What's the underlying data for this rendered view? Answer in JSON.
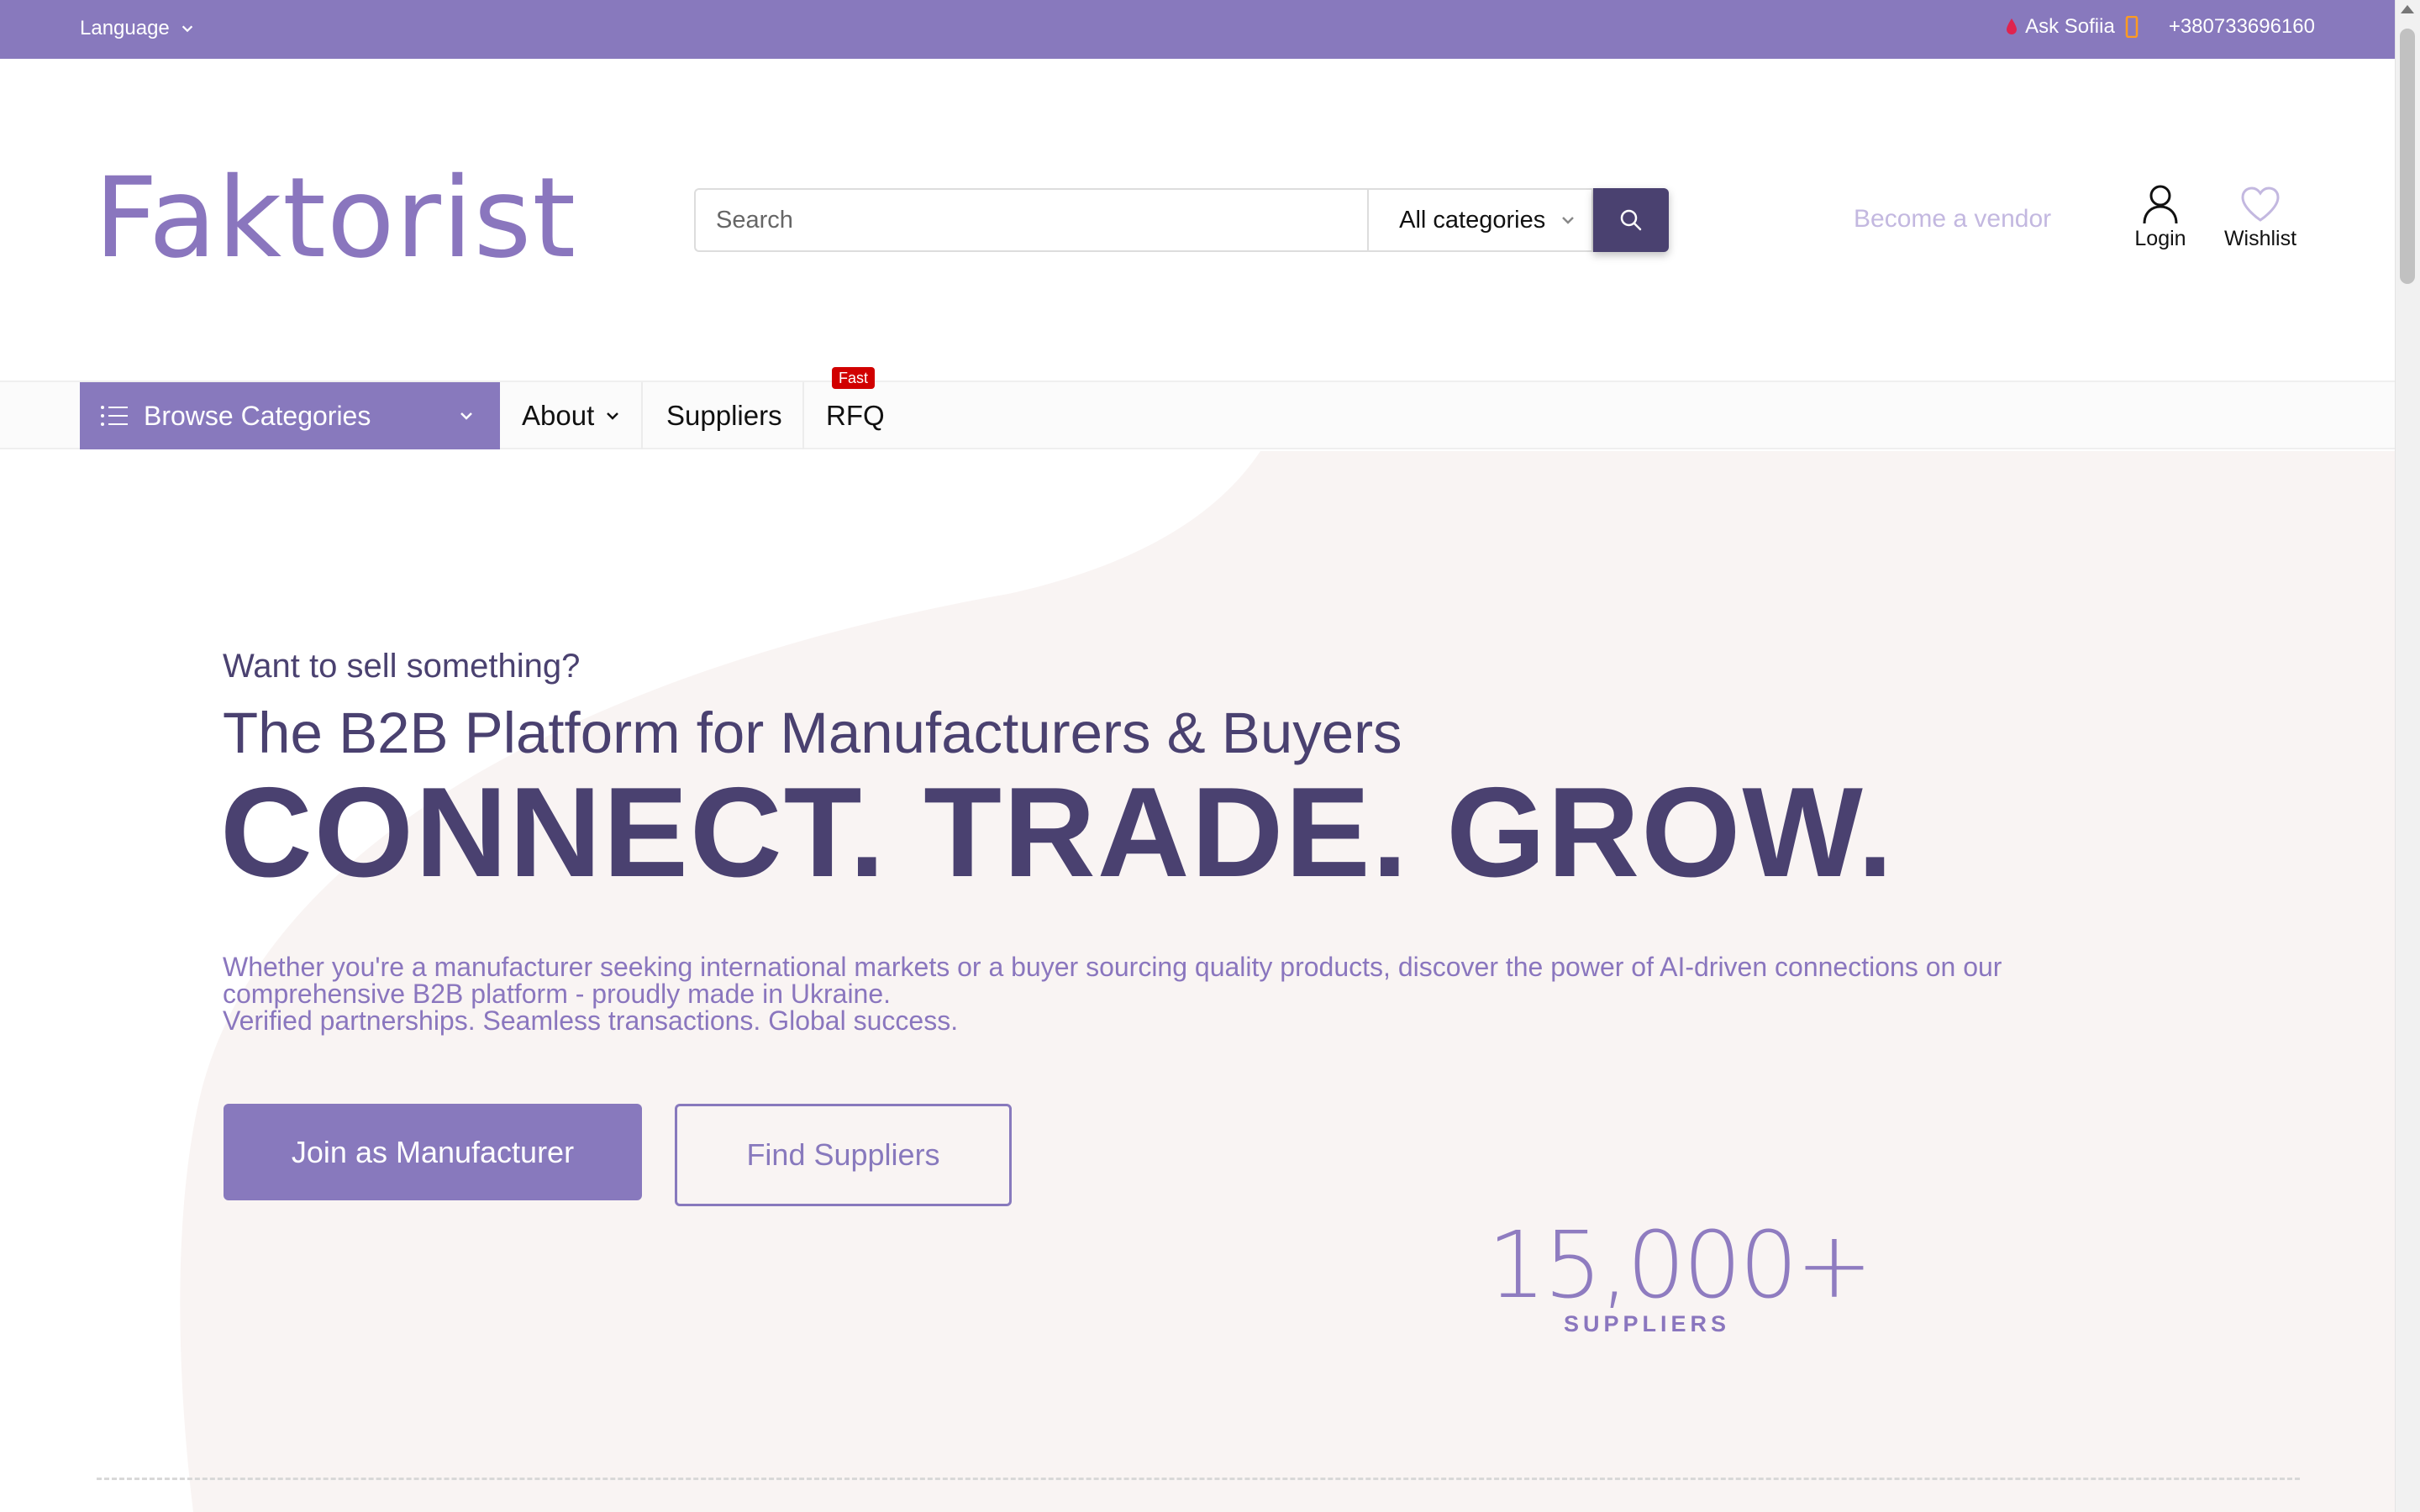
{
  "topbar": {
    "language_label": "Language",
    "ask_label": "Ask Sofiia",
    "phone": "+380733696160"
  },
  "header": {
    "logo_text": "Faktorist",
    "search": {
      "placeholder": "Search",
      "value": ""
    },
    "category_select": "All categories",
    "become_vendor": "Become a vendor",
    "login_label": "Login",
    "wishlist_label": "Wishlist"
  },
  "nav": {
    "browse_label": "Browse Categories",
    "items": [
      {
        "label": "About"
      },
      {
        "label": "Suppliers"
      },
      {
        "label": "RFQ",
        "badge": "Fast"
      }
    ]
  },
  "hero": {
    "eyebrow": "Want to sell something?",
    "subtitle": "The B2B Platform for Manufacturers & Buyers",
    "headline": "CONNECT. TRADE. GROW.",
    "description_line1": "Whether you're a manufacturer seeking international markets or a buyer sourcing quality products, discover the power of AI-driven connections on our comprehensive B2B platform - proudly made in Ukraine.",
    "description_line2": "Verified partnerships. Seamless transactions. Global success.",
    "primary_button": "Join as Manufacturer",
    "secondary_button": "Find Suppliers",
    "stat_value": "15,000+",
    "stat_label": "SUPPLIERS"
  },
  "colors": {
    "brand_purple": "#8879bd",
    "dark_purple": "#4a4170",
    "hero_bg": "#f9f4f3",
    "badge_red": "#d10000"
  },
  "icons": [
    "chevron-down-icon",
    "drop-icon",
    "phone-icon",
    "search-icon",
    "user-icon",
    "heart-icon",
    "list-icon"
  ]
}
